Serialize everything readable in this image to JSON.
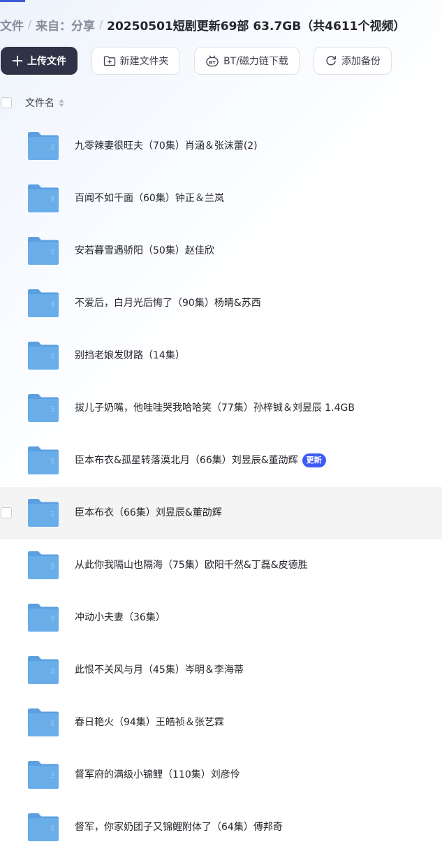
{
  "breadcrumb": {
    "items": [
      "文件",
      "来自：分享"
    ],
    "separator": "/",
    "current": "20250501短剧更新69部 63.7GB（共4611个视频）"
  },
  "toolbar": {
    "upload_label": "上传文件",
    "new_folder_label": "新建文件夹",
    "bt_label": "BT/磁力链下载",
    "backup_label": "添加备份"
  },
  "list": {
    "header_name": "文件名",
    "rows": [
      {
        "name": "九零辣妻很旺夫（70集）肖涵＆张沫蕾(2)",
        "badge": ""
      },
      {
        "name": "百闻不如千面（60集）钟正＆兰岚",
        "badge": ""
      },
      {
        "name": "安若暮雪遇骄阳（50集）赵佳欣",
        "badge": ""
      },
      {
        "name": "不爱后，白月光后悔了（90集）杨晴&苏西",
        "badge": ""
      },
      {
        "name": "别挡老娘发财路（14集）",
        "badge": ""
      },
      {
        "name": "拔儿子奶嘴，他哇哇哭我哈哈笑（77集）孙梓铖＆刘昱辰 1.4GB",
        "badge": ""
      },
      {
        "name": "臣本布衣&孤星转落漠北月（66集）刘昱辰&董劭辉",
        "badge": "更新"
      },
      {
        "name": "臣本布衣（66集）刘昱辰&董劭辉",
        "badge": ""
      },
      {
        "name": "从此你我隔山也隔海（75集）欧阳千然&丁磊&皮德胜",
        "badge": ""
      },
      {
        "name": "冲动小夫妻（36集）",
        "badge": ""
      },
      {
        "name": "此恨不关风与月（45集）岑明＆李海蒂",
        "badge": ""
      },
      {
        "name": "春日艳火（94集）王皓祯＆张艺霖",
        "badge": ""
      },
      {
        "name": "督军府的满级小锦鲤（110集）刘彦伶",
        "badge": ""
      },
      {
        "name": "督军，你家奶团子又锦鲤附体了（64集）傅邦奇",
        "badge": ""
      }
    ]
  },
  "colors": {
    "primary_button": "#2f3347",
    "badge": "#3d5cf5",
    "folder": "#6aaee9",
    "row_hover": "#f4f4f5"
  }
}
